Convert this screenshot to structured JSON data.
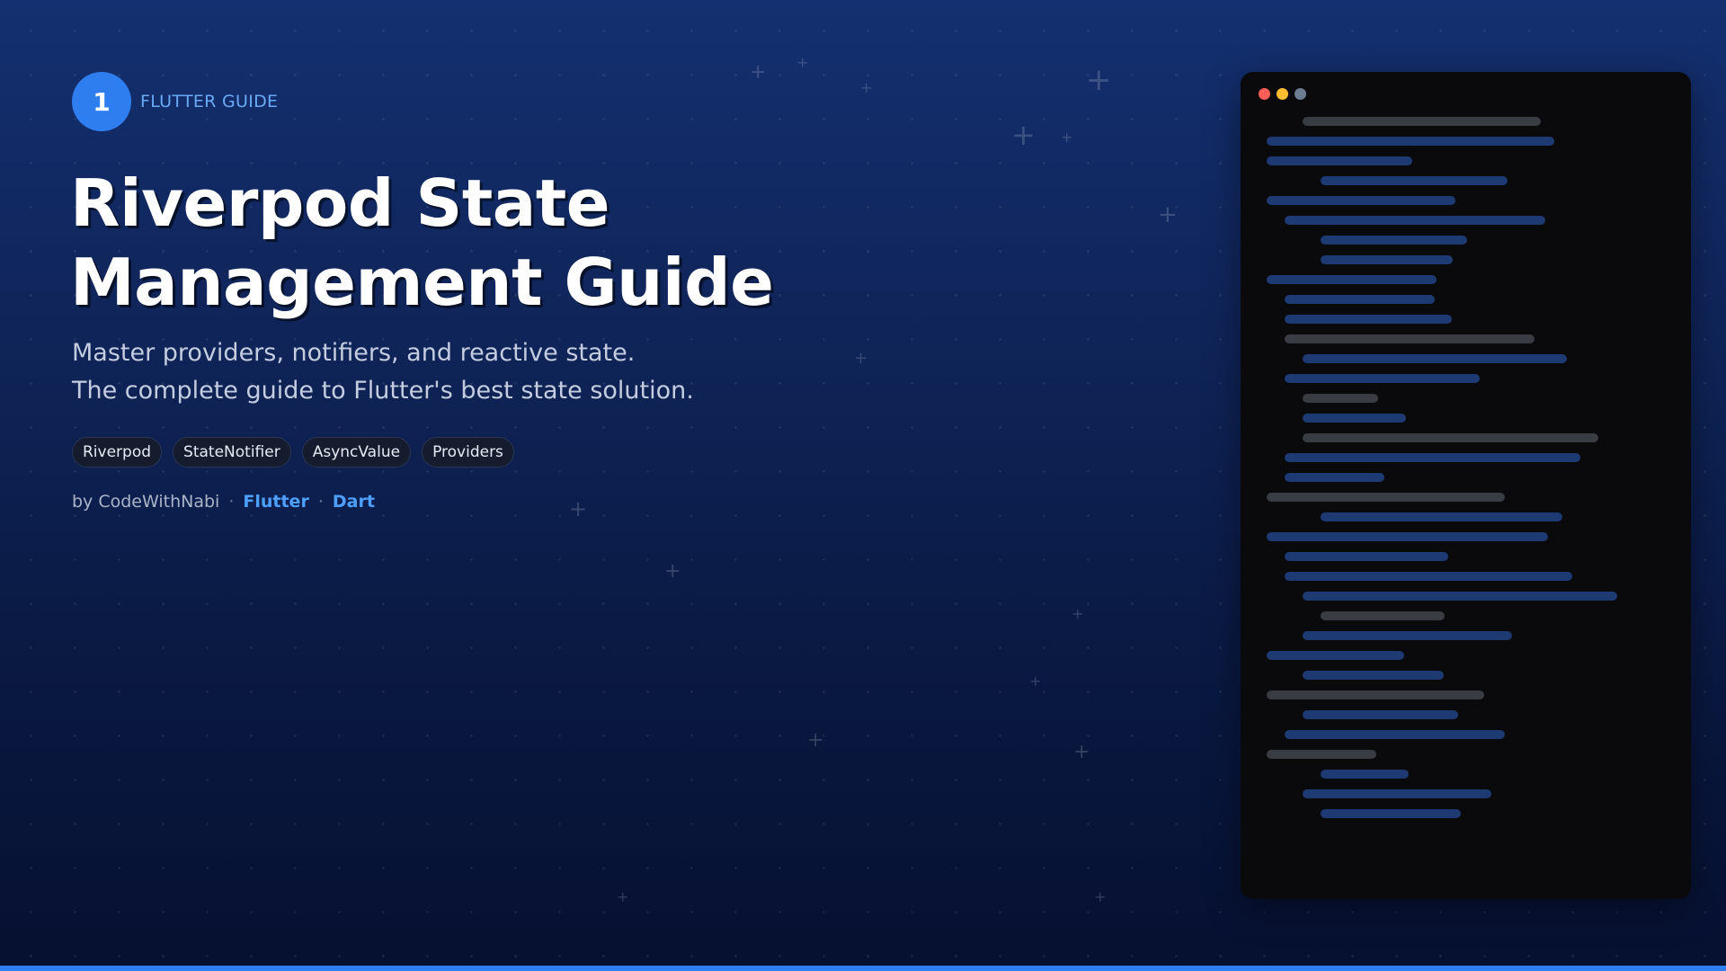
{
  "badge": {
    "number": "1",
    "label": "FLUTTER GUIDE"
  },
  "title": {
    "line1": "Riverpod State",
    "line2": "Management Guide"
  },
  "subtitle": {
    "line1": "Master providers, notifiers, and reactive state.",
    "line2": "The complete guide to Flutter's best state solution."
  },
  "tags": [
    "Riverpod",
    "StateNotifier",
    "AsyncValue",
    "Providers"
  ],
  "byline": {
    "author": "by CodeWithNabi",
    "separator": "·",
    "topic1": "Flutter",
    "topic2": "Dart"
  },
  "code_window": {
    "traffic_lights": [
      "#ff5f57",
      "#febc2e",
      "#6b7c93"
    ],
    "line_colors": {
      "blue": "#1d3a73",
      "gray": "#3a3c44"
    },
    "background": "#0a0a0c"
  },
  "colors": {
    "accent": "#2f7ef0",
    "accent_text": "#4ea0ff",
    "badge_label": "#6aaaf5"
  }
}
